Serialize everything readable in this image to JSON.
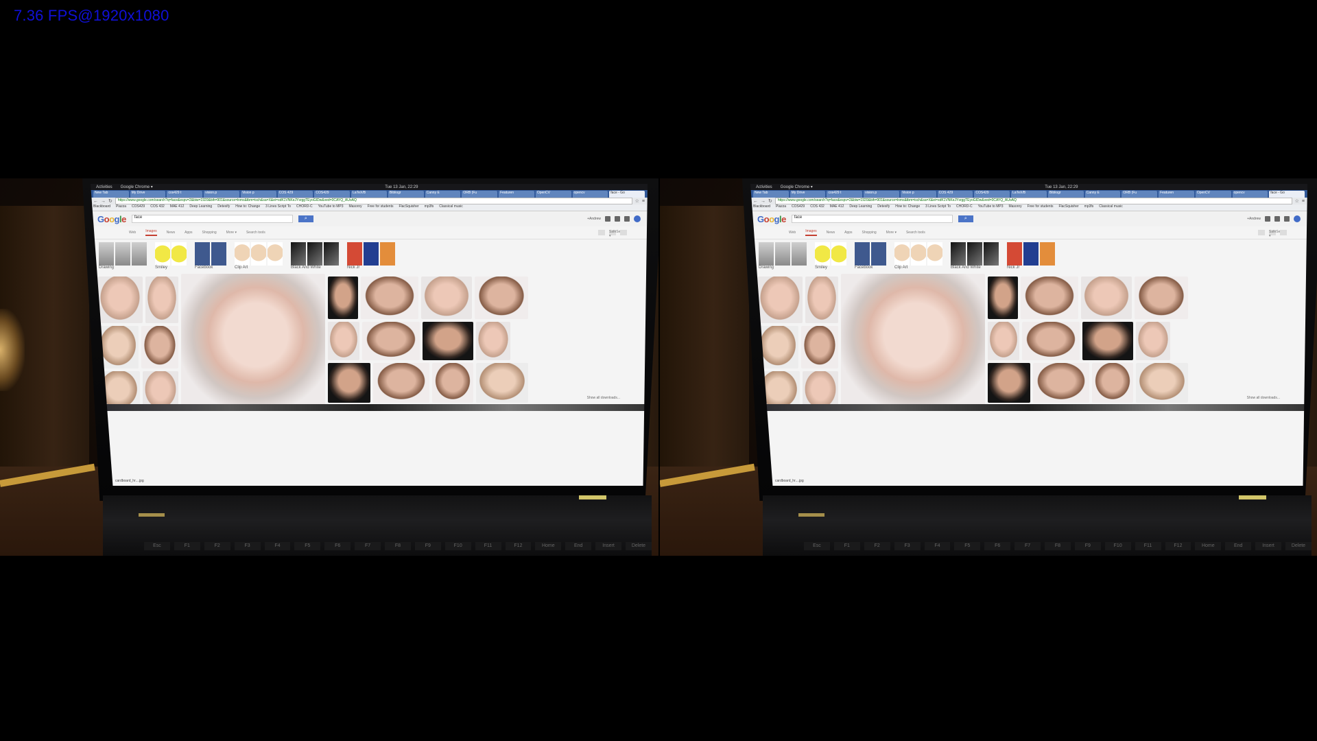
{
  "overlay": {
    "fps_text": "7.36 FPS@1920x1080"
  },
  "gnome": {
    "activities": "Activities",
    "app": "Google Chrome ▾",
    "clock": "Tue 13 Jan, 22:29"
  },
  "tabs": [
    "New Tab",
    "My Drive",
    "cos429 t",
    "vision.p",
    "Vision p",
    "COS 429",
    "COS429",
    "LaTeX/B",
    "Bibliogr",
    "Canny E",
    "ORB (Fu",
    "Featuren",
    "OpenCV",
    "opencv",
    "face - Go"
  ],
  "address_bar": {
    "url": "https://www.google.com/search?q=face&espv=2&biw=1920&bih=901&source=lnms&tbm=isch&sa=X&ei=xdK1VNKeJYsrggTEyoGIDw&ved=0CAYQ_AUoAQ"
  },
  "bookmarks": [
    "Blackboard",
    "Piazza",
    "COS429",
    "COS 432",
    "MAE 412",
    "Deep Learning",
    "Detexify",
    "How to: Change",
    "3 Lines Script To",
    "CHORD-C",
    "YouTube to MP3",
    "Masonry",
    "Free for students",
    "FlacSquisher",
    "mp3fs",
    "Classical music"
  ],
  "google": {
    "logo": [
      "G",
      "o",
      "o",
      "g",
      "l",
      "e"
    ],
    "query": "face",
    "search_icon": "search-icon",
    "user": "+Andrew",
    "tabs": [
      "Web",
      "Images",
      "News",
      "Apps",
      "Shopping",
      "More ▾",
      "Search tools"
    ],
    "active_tab": "Images",
    "safesearch": "SafeSearch ▾",
    "categories": [
      "Drawing",
      "Smiley",
      "Facebook",
      "Clip Art",
      "Black And White",
      "Nick Jr"
    ],
    "show_all_downloads": "Show all downloads...",
    "download_file": "cardboard_hr....jpg"
  },
  "keyboard": {
    "keys": [
      "Esc",
      "F1",
      "F2",
      "F3",
      "F4",
      "F5",
      "F6",
      "F7",
      "F8",
      "F9",
      "F10",
      "F11",
      "F12",
      "Home",
      "End",
      "Insert",
      "Delete"
    ]
  }
}
